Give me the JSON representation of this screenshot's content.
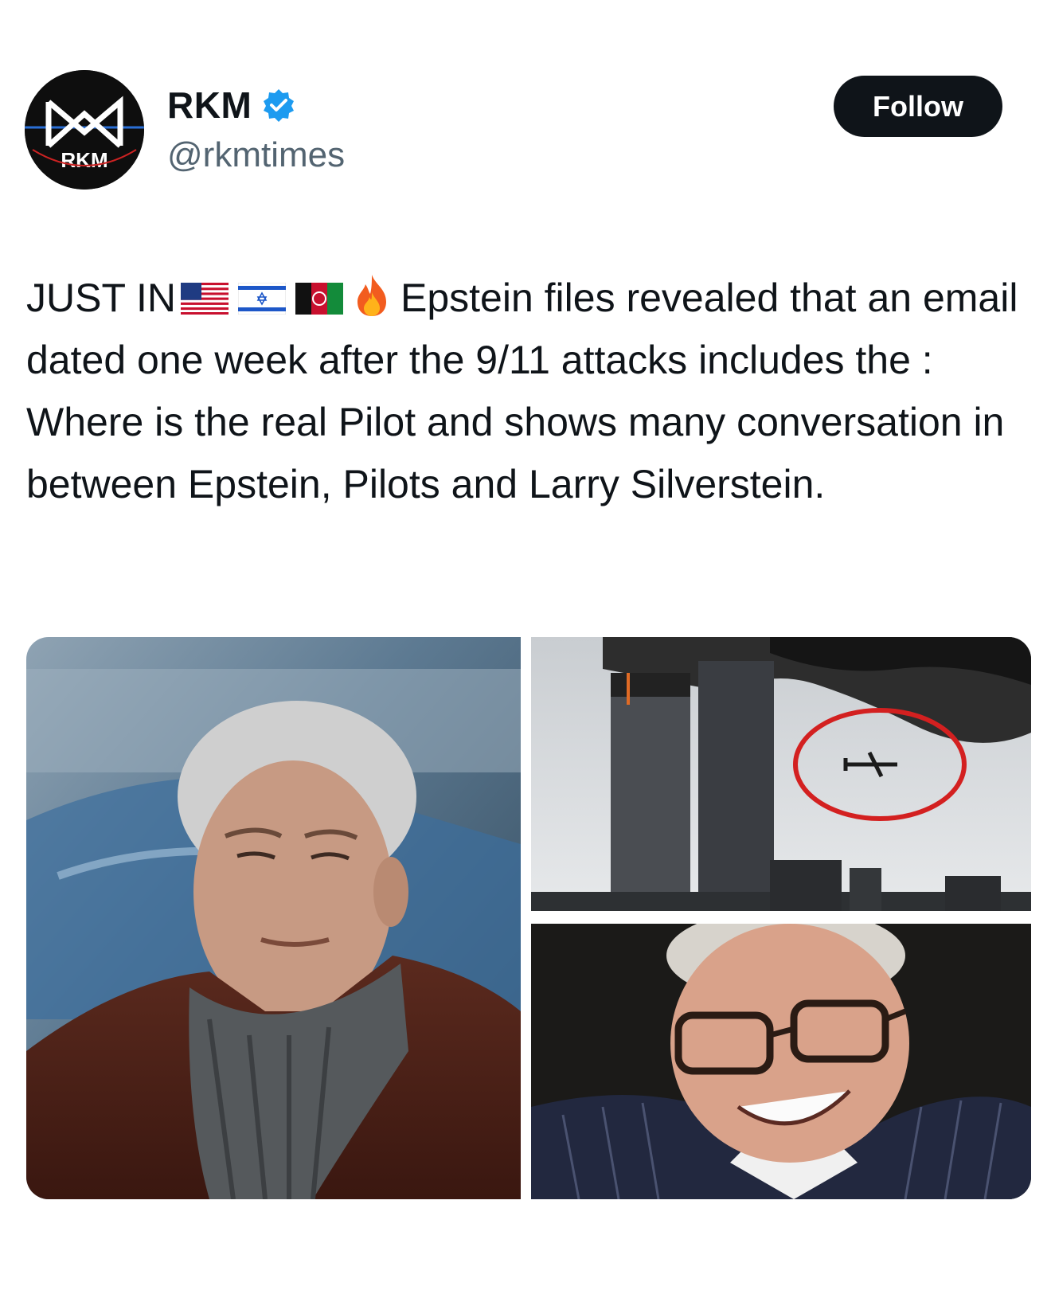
{
  "author": {
    "display_name": "RKM",
    "handle": "@rkmtimes",
    "avatar_text": "RKM",
    "verified": true
  },
  "follow_label": "Follow",
  "tweet": {
    "prefix": "JUST IN",
    "flags": [
      "us-flag-icon",
      "israel-flag-icon",
      "afghanistan-flag-icon"
    ],
    "emoji": "fire-icon",
    "body": "Epstein files revealed that an email dated one week after the 9/11 attacks includes the : Where is the real Pilot and shows many conversation in between Epstein, Pilots and Larry Silverstein."
  },
  "media": [
    {
      "name": "photo-man-scarf",
      "description": ""
    },
    {
      "name": "photo-towers-plane",
      "description": ""
    },
    {
      "name": "photo-man-glasses",
      "description": ""
    }
  ],
  "colors": {
    "text": "#0f1419",
    "secondary": "#536471",
    "verified": "#1d9bf0",
    "button": "#0f1419",
    "highlight_circle": "#d32020"
  }
}
